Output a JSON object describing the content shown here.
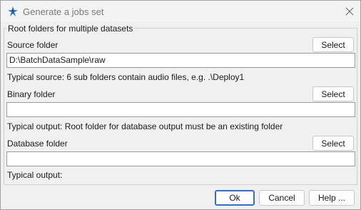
{
  "window": {
    "title": "Generate a jobs set",
    "icons": {
      "app": "app-logo-icon",
      "close": "close-icon"
    }
  },
  "group": {
    "title": "Root folders for multiple datasets"
  },
  "source": {
    "label": "Source folder",
    "select_label": "Select",
    "value": "D:\\BatchDataSample\\raw",
    "hint": "Typical source:  6 sub folders contain audio files, e.g. .\\Deploy1"
  },
  "binary": {
    "label": "Binary folder",
    "select_label": "Select",
    "value": "",
    "hint": "Typical output:  Root folder for database output must be an existing folder"
  },
  "database": {
    "label": "Database folder",
    "select_label": "Select",
    "value": "",
    "hint": "Typical output:"
  },
  "footer": {
    "ok_label": "Ok",
    "cancel_label": "Cancel",
    "help_label": "Help ..."
  },
  "colors": {
    "accent": "#2f6fd0",
    "title_text": "#7a7a7a"
  }
}
